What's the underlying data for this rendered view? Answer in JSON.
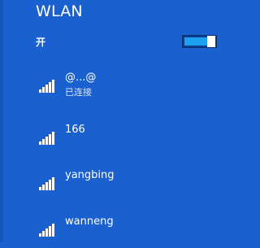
{
  "panel": {
    "title": "WLAN",
    "toggle": {
      "label": "开",
      "state": "on",
      "accent_color": "#1ea0f0"
    }
  },
  "networks": [
    {
      "ssid": "@...@",
      "status": "已连接",
      "signal_icon": "wifi-signal-icon"
    },
    {
      "ssid": "166",
      "status": "",
      "signal_icon": "wifi-signal-icon"
    },
    {
      "ssid": "yangbing",
      "status": "",
      "signal_icon": "wifi-signal-icon"
    },
    {
      "ssid": "wanneng",
      "status": "",
      "signal_icon": "wifi-signal-icon"
    }
  ],
  "colors": {
    "background": "#1a60cf",
    "text": "#ffffff",
    "muted_text": "#d6e4ff"
  }
}
